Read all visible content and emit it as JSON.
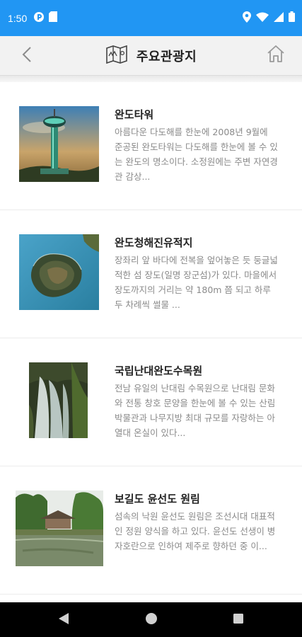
{
  "status_bar": {
    "time": "1:50",
    "icons": [
      "notification-icon",
      "sim-card-icon",
      "location-icon",
      "wifi-icon",
      "signal-icon",
      "battery-icon"
    ]
  },
  "header": {
    "title": "주요관광지",
    "title_icon": "map-icon",
    "back_icon": "chevron-left-icon",
    "home_icon": "home-icon"
  },
  "items": [
    {
      "title": "완도타워",
      "description": "아름다운 다도해를 한눈에 2008년 9월에 준공된 완도타워는 다도해를 한눈에 볼 수 있는 완도의 명소이다. 소정원에는 주변 자연경관 감상...",
      "image": "tower-photo"
    },
    {
      "title": "완도청해진유적지",
      "description": "장좌리 앞 바다에 전복을 엎어놓은 듯 둥글넓적한 섬 장도(일명 장군섬)가 있다. 마을에서 장도까지의 거리는 약 180m 쯤 되고 하루 두 차례씩 썰물 ...",
      "image": "island-photo"
    },
    {
      "title": "국립난대완도수목원",
      "description": "전남 유일의 난대림 수목원으로 난대림 문화와 전통 창호 문양을 한눈에 볼 수 있는 산림박물관과 나무지방 최대 규모를 자랑하는 아열대 온실이 있다...",
      "image": "waterfall-photo"
    },
    {
      "title": "보길도 윤선도 원림",
      "description": "섬속의 낙원 윤선도 원림은 조선시대 대표적인 정원 양식을 하고 있다. 윤선도 선생이 병자호란으로 인하여 제주로 향하던 중 이...",
      "image": "garden-photo"
    }
  ],
  "nav_bar": {
    "icons": [
      "back-triangle-icon",
      "home-circle-icon",
      "recents-square-icon"
    ]
  }
}
